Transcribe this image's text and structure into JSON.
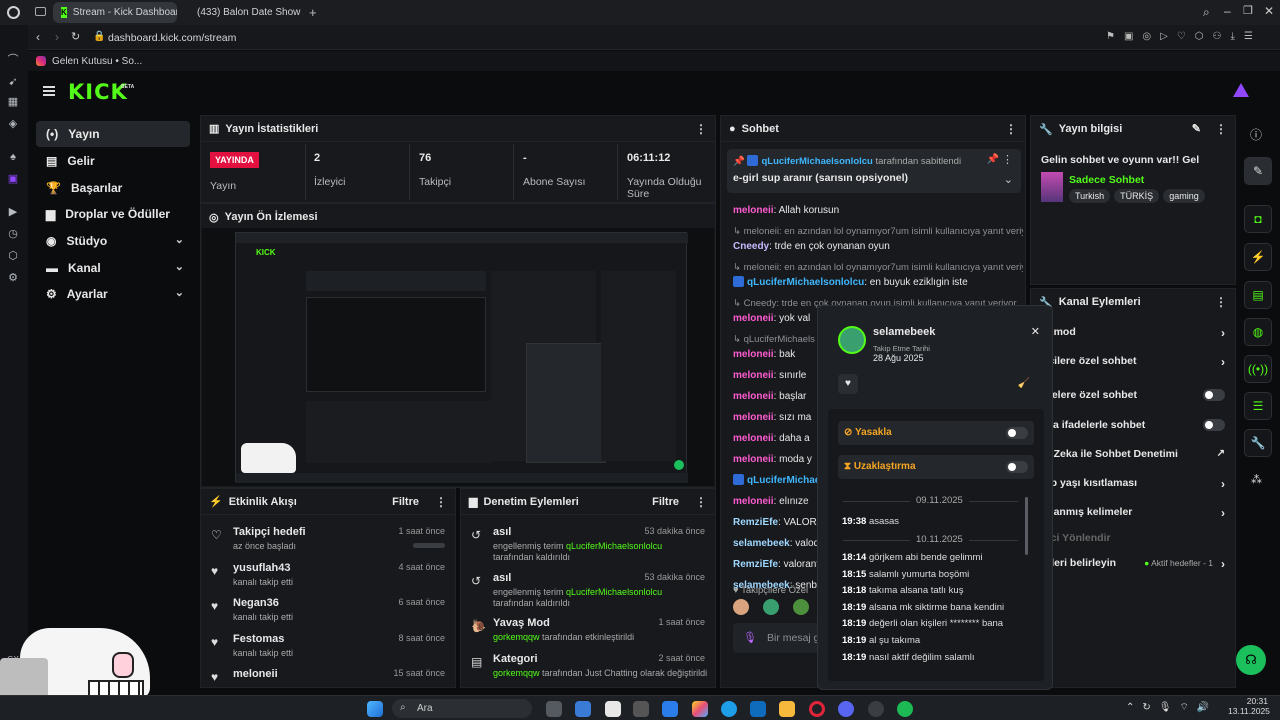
{
  "browser": {
    "tabs": [
      {
        "label": "Stream - Kick Dashboard"
      },
      {
        "label": "(433) Balon Date Show T..."
      }
    ],
    "new_tab": "+",
    "url": "dashboard.kick.com/stream",
    "bookmark": "Gelen Kutusu • So...",
    "gx_label": "GX"
  },
  "kick": {
    "logo": "KICK",
    "beta": "BETA",
    "nav": [
      {
        "label": "Yayın",
        "icon": "(•)"
      },
      {
        "label": "Gelir",
        "icon": "▤"
      },
      {
        "label": "Başarılar",
        "icon": "🏆"
      },
      {
        "label": "Droplar ve Ödüller",
        "icon": "▆"
      },
      {
        "label": "Stüdyo",
        "icon": "◉"
      },
      {
        "label": "Kanal",
        "icon": "▬"
      },
      {
        "label": "Ayarlar",
        "icon": "⚙"
      }
    ]
  },
  "stats": {
    "title": "Yayın İstatistikleri",
    "live_badge": "YAYINDA",
    "items": [
      {
        "value": "",
        "label": "Yayın"
      },
      {
        "value": "2",
        "label": "İzleyici"
      },
      {
        "value": "76",
        "label": "Takipçi"
      },
      {
        "value": "-",
        "label": "Abone Sayısı"
      },
      {
        "value": "06:11:12",
        "label": "Yayında Olduğu Süre"
      }
    ]
  },
  "preview": {
    "title": "Yayın Ön İzlemesi"
  },
  "activity": {
    "title": "Etkinlik Akışı",
    "filter": "Filtre",
    "items": [
      {
        "title": "Takipçi hedefi",
        "sub": "az önce başladı",
        "time": "1 saat önce"
      },
      {
        "title": "yusuflah43",
        "sub": "kanalı takip etti",
        "time": "4 saat önce"
      },
      {
        "title": "Negan36",
        "sub": "kanalı takip etti",
        "time": "6 saat önce"
      },
      {
        "title": "Festomas",
        "sub": "kanalı takip etti",
        "time": "8 saat önce"
      },
      {
        "title": "meloneii",
        "sub": "",
        "time": "15 saat önce"
      }
    ]
  },
  "moderation": {
    "title": "Denetim Eylemleri",
    "filter": "Filtre",
    "items": [
      {
        "title": "asıl",
        "pre": "engellenmiş terim ",
        "user": "qLuciferMichaelsonlolcu",
        "post": " tarafından kaldırıldı",
        "time": "53 dakika önce"
      },
      {
        "title": "asıl",
        "pre": "engellenmiş terim ",
        "user": "qLuciferMichaelsonlolcu",
        "post": " tarafından kaldırıldı",
        "time": "53 dakika önce"
      },
      {
        "title": "Yavaş Mod",
        "pre": "",
        "user": "gorkemqqw",
        "post": " tarafından etkinleştirildi",
        "time": "1 saat önce"
      },
      {
        "title": "Kategori",
        "pre": "",
        "user": "gorkemqqw",
        "post": " tarafından Just Chatting olarak değiştirildi",
        "time": "2 saat önce"
      }
    ]
  },
  "chat": {
    "title": "Sohbet",
    "pinned_by_user": "qLuciferMichaelsonlolcu",
    "pinned_by_text": " tarafından sabitlendi",
    "pinned_message": "e-girl sup aranır (sarısın opsiyonel)",
    "lines": [
      {
        "reply": "",
        "name": "meloneii",
        "color": "P",
        "text": ": Allah korusun"
      },
      {
        "reply": "↳ meloneii: en azından lol oynamıyor7um isimli kullanıcıya yanıt veriyor",
        "name": "Cneedy",
        "color": "Y",
        "text": ": trde en çok oynanan oyun"
      },
      {
        "reply": "↳ meloneii: en azından lol oynamıyor7um isimli kullanıcıya yanıt veriyor",
        "name": "qLuciferMichaelsonlolcu",
        "color": "B",
        "text": ": en buyuk eziklıgin iste"
      },
      {
        "reply": "↳ Cneedy: trde en çok oynanan oyun isimli kullanıcıya yanıt veriyor",
        "name": "meloneii",
        "color": "P",
        "text": ": yok val"
      },
      {
        "reply": "↳ qLuciferMichaels",
        "name": "meloneii",
        "color": "P",
        "text": ": bak"
      },
      {
        "reply": "",
        "name": "meloneii",
        "color": "P",
        "text": ": sınırle"
      },
      {
        "reply": "",
        "name": "meloneii",
        "color": "P",
        "text": ": başlar"
      },
      {
        "reply": "",
        "name": "meloneii",
        "color": "P",
        "text": ": sızı ma"
      },
      {
        "reply": "",
        "name": "meloneii",
        "color": "P",
        "text": ": daha a"
      },
      {
        "reply": "",
        "name": "meloneii",
        "color": "P",
        "text": ": moda y"
      },
      {
        "reply": "",
        "name": "qLuciferMichae",
        "color": "B",
        "text": ""
      },
      {
        "reply": "",
        "name": "meloneii",
        "color": "P",
        "text": ": elınıze"
      },
      {
        "reply": "",
        "name": "RemziEfe",
        "color": "W",
        "text": ": VALORAN"
      },
      {
        "reply": "",
        "name": "selamebeek",
        "color": "W",
        "text": ": valoda"
      },
      {
        "reply": "",
        "name": "RemziEfe",
        "color": "W",
        "text": ": valorant g"
      },
      {
        "reply": "",
        "name": "selamebeek",
        "color": "W",
        "text": ": senbd"
      }
    ],
    "followers_only": "Takipçilere Özel",
    "input_placeholder": "Bir mesaj g"
  },
  "stream_info": {
    "title": "Yayın bilgisi",
    "stream_title": "Gelin sohbet ve oyunn var!! Gel",
    "category": "Sadece Sohbet",
    "tags": [
      "Turkish",
      "TÜRKİŞ",
      "gaming"
    ]
  },
  "channel_actions": {
    "title": "Kanal Eylemleri",
    "items": [
      {
        "label": "aş mod",
        "kind": "chevron"
      },
      {
        "label": "ipçilere özel sohbet",
        "kind": "chevron"
      },
      {
        "label": "onelere özel sohbet",
        "kind": "toggle"
      },
      {
        "label": "ızca ifadelerle sohbet",
        "kind": "toggle"
      },
      {
        "label": "ay Zeka ile Sohbet Denetimi",
        "kind": "external"
      },
      {
        "label": "şap yaşı kısıtlaması",
        "kind": "chevron"
      },
      {
        "label": "aklanmış kelimeler",
        "kind": "chevron"
      },
      {
        "label": "lyici Yönlendir",
        "kind": "none"
      },
      {
        "label": "lefleri belirleyin",
        "kind": "chevron"
      }
    ],
    "active_goals": "Aktif hedefler - 1"
  },
  "user_card": {
    "username": "selamebeek",
    "follow_label": "Takip Etme Tarihi",
    "follow_date": "28 Ağu 2025",
    "ban_label": "Yasakla",
    "timeout_label": "Uzaklaştırma",
    "date1": "09.11.2025",
    "date2": "10.11.2025",
    "log": [
      {
        "time": "19:38",
        "msg": "asasas"
      },
      {
        "time": "18:14",
        "msg": "görjkem abi bende gelimmi"
      },
      {
        "time": "18:15",
        "msg": "salamlı yumurta boşömi"
      },
      {
        "time": "18:18",
        "msg": "takıma alsana tatlı kuş"
      },
      {
        "time": "18:19",
        "msg": "alsana mk siktirme bana kendini"
      },
      {
        "time": "18:19",
        "msg": "değerli olan kişileri ******** bana"
      },
      {
        "time": "18:19",
        "msg": "al şu takıma"
      },
      {
        "time": "18:19",
        "msg": "nasıl aktif değilim salamlı"
      }
    ]
  },
  "taskbar": {
    "search": "Ara",
    "time": "20:31",
    "date": "13.11.2025"
  },
  "colors": {
    "accent": "#53fc18",
    "live": "#e3113f",
    "panel": "#17191c"
  }
}
